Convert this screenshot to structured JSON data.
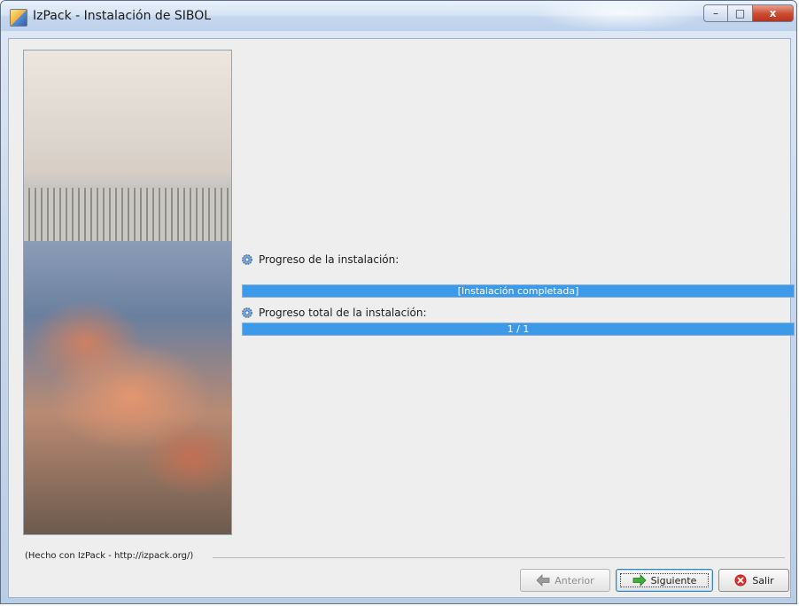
{
  "window": {
    "title": "IzPack - Instalación de  SIBOL",
    "controls": {
      "minimize": "–",
      "maximize": "□",
      "close": "x"
    }
  },
  "panel": {
    "install_progress_label": "Progreso de la instalación:",
    "install_progress_text": "[Instalación completada]",
    "install_progress_fraction": 1.0,
    "total_progress_label": "Progreso total de la instalación:",
    "total_progress_text": "1 / 1",
    "total_progress_fraction": 1.0
  },
  "footer": {
    "credit": "(Hecho con IzPack - http://izpack.org/)"
  },
  "buttons": {
    "previous": "Anterior",
    "next": "Siguiente",
    "exit": "Salir"
  },
  "colors": {
    "progress_fill": "#3d9ae8",
    "panel_bg": "#eeeeee",
    "next_icon": "#3fae3a",
    "exit_icon": "#d8322b"
  },
  "icons": {
    "app": "izpack-app-icon",
    "progress": "gear-icon",
    "previous": "arrow-left-icon",
    "next": "arrow-right-icon",
    "exit": "cancel-x-icon"
  }
}
